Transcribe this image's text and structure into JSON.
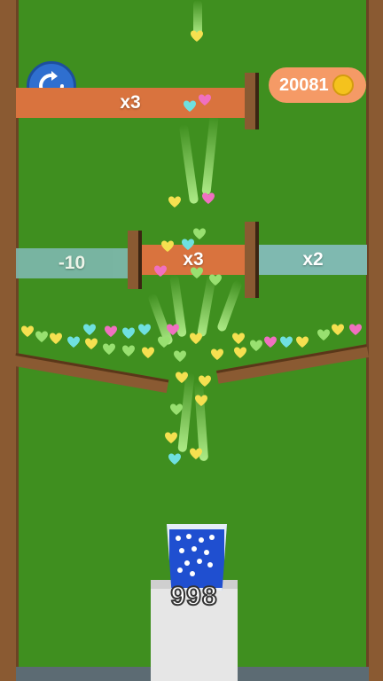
{
  "hud": {
    "restart_icon": "restart-icon",
    "coin_count": "20081",
    "coin_icon": "gold-coin-icon"
  },
  "gates": {
    "top_multiplier": "x3",
    "minus_label": "-10",
    "middle_multiplier": "x3",
    "right_multiplier": "x2"
  },
  "cup": {
    "count": "998"
  },
  "colors": {
    "background": "#3f8f1f",
    "orange_gate": "#d9733e",
    "teal_gate": "#7fb9b0",
    "cup": "#1f4fd0",
    "hearts": [
      "#f5e050",
      "#6fe0e0",
      "#f070c0",
      "#98e070"
    ]
  }
}
